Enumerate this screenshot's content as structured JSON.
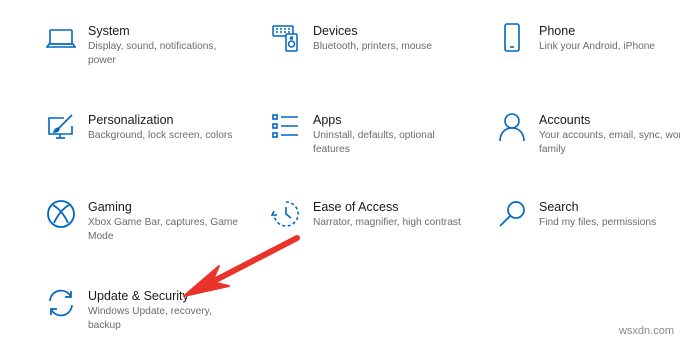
{
  "accent_color": "#0067c0",
  "annotation_arrow_color": "#e8322a",
  "tiles": [
    {
      "title": "System",
      "description": "Display, sound, notifications, power",
      "icon": "laptop-icon"
    },
    {
      "title": "Devices",
      "description": "Bluetooth, printers, mouse",
      "icon": "devices-icon"
    },
    {
      "title": "Phone",
      "description": "Link your Android, iPhone",
      "icon": "phone-icon"
    },
    {
      "title": "Personalization",
      "description": "Background, lock screen, colors",
      "icon": "personalization-icon"
    },
    {
      "title": "Apps",
      "description": "Uninstall, defaults, optional features",
      "icon": "apps-list-icon"
    },
    {
      "title": "Accounts",
      "description": "Your accounts, email, sync, work, family",
      "icon": "person-icon"
    },
    {
      "title": "Gaming",
      "description": "Xbox Game Bar, captures, Game Mode",
      "icon": "xbox-icon"
    },
    {
      "title": "Ease of Access",
      "description": "Narrator, magnifier, high contrast",
      "icon": "ease-of-access-icon"
    },
    {
      "title": "Search",
      "description": "Find my files, permissions",
      "icon": "search-icon"
    },
    {
      "title": "Update & Security",
      "description": "Windows Update, recovery, backup",
      "icon": "sync-icon"
    }
  ],
  "watermark": "wsxdn.com"
}
